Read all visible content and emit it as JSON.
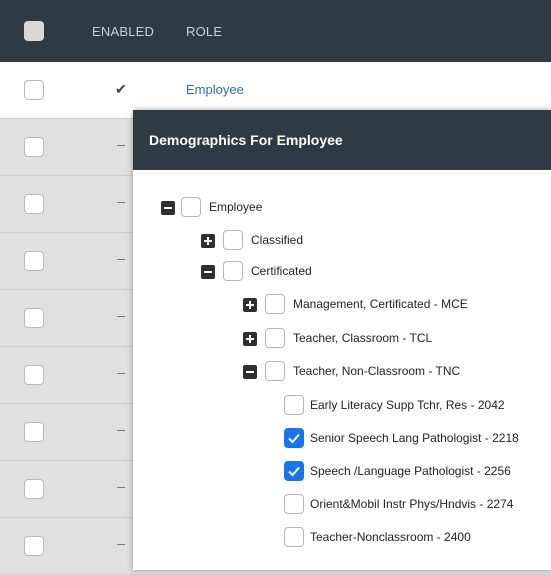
{
  "table": {
    "headers": {
      "enabled": "ENABLED",
      "role": "ROLE"
    },
    "rows": [
      {
        "enabled": true,
        "role": "Employee"
      },
      {
        "enabled": false,
        "role": ""
      },
      {
        "enabled": false,
        "role": ""
      },
      {
        "enabled": false,
        "role": ""
      },
      {
        "enabled": false,
        "role": ""
      },
      {
        "enabled": false,
        "role": ""
      },
      {
        "enabled": false,
        "role": ""
      },
      {
        "enabled": false,
        "role": ""
      },
      {
        "enabled": false,
        "role": ""
      }
    ]
  },
  "modal": {
    "title": "Demographics For Employee",
    "tree": [
      {
        "label": "Employee",
        "expanded": true,
        "checked": false
      },
      {
        "label": "Classified",
        "expanded": false,
        "checked": false
      },
      {
        "label": "Certificated",
        "expanded": true,
        "checked": false
      },
      {
        "label": "Management, Certificated - MCE",
        "expanded": false,
        "checked": false
      },
      {
        "label": "Teacher, Classroom - TCL",
        "expanded": false,
        "checked": false
      },
      {
        "label": "Teacher, Non-Classroom - TNC",
        "expanded": true,
        "checked": false
      },
      {
        "label": "Early Literacy Supp Tchr, Res - 2042",
        "checked": false
      },
      {
        "label": "Senior Speech Lang Pathologist - 2218",
        "checked": true
      },
      {
        "label": "Speech /Language Pathologist - 2256",
        "checked": true
      },
      {
        "label": "Orient&Mobil Instr Phys/Hndvis - 2274",
        "checked": false
      },
      {
        "label": "Teacher-Nonclassroom - 2400",
        "checked": false
      }
    ]
  },
  "colors": {
    "header": "#2f3b44",
    "checkbox_checked": "#1a73e8",
    "link": "#2d6fa3"
  }
}
